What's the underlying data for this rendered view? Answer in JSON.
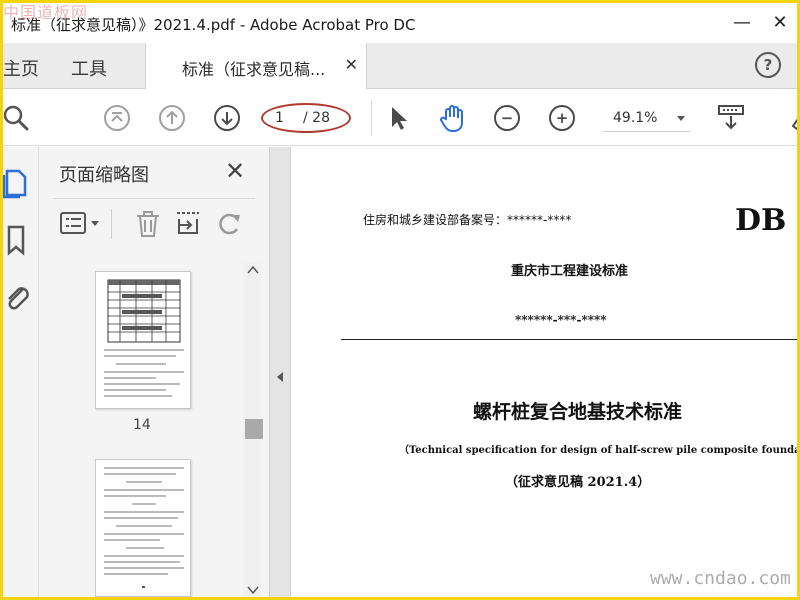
{
  "window": {
    "title": "标准（征求意见稿）》2021.4.pdf - Adobe Acrobat Pro DC",
    "minimize_glyph": "—",
    "close_glyph": "✕"
  },
  "watermarks": {
    "top": "中国道板网",
    "bottom": "www.cndao.com"
  },
  "tabs": {
    "home": "主页",
    "tools": "工具",
    "document": "标准（征求意见稿...",
    "document_close": "✕",
    "help": "?"
  },
  "toolbar": {
    "current_page": "1",
    "total_pages": "/ 28",
    "zoom": "49.1%",
    "zoom_out_glyph": "−",
    "zoom_in_glyph": "+"
  },
  "thumbnails_panel": {
    "title": "页面缩略图",
    "close": "✕",
    "page_label": "14"
  },
  "document": {
    "record_number": "住房和城乡建设部备案号：******-****",
    "series": "DB",
    "organization": "重庆市工程建设标准",
    "code": "******-***-****",
    "title": "螺杆桩复合地基技术标准",
    "subtitle": "（Technical specification for design of half-screw pile composite foundation）",
    "draft_note": "（征求意见稿 2021.4）"
  },
  "colors": {
    "frame_border": "#f4d40d",
    "annotation_oval": "#b03a2e",
    "accent_blue": "#2d6fd8"
  }
}
